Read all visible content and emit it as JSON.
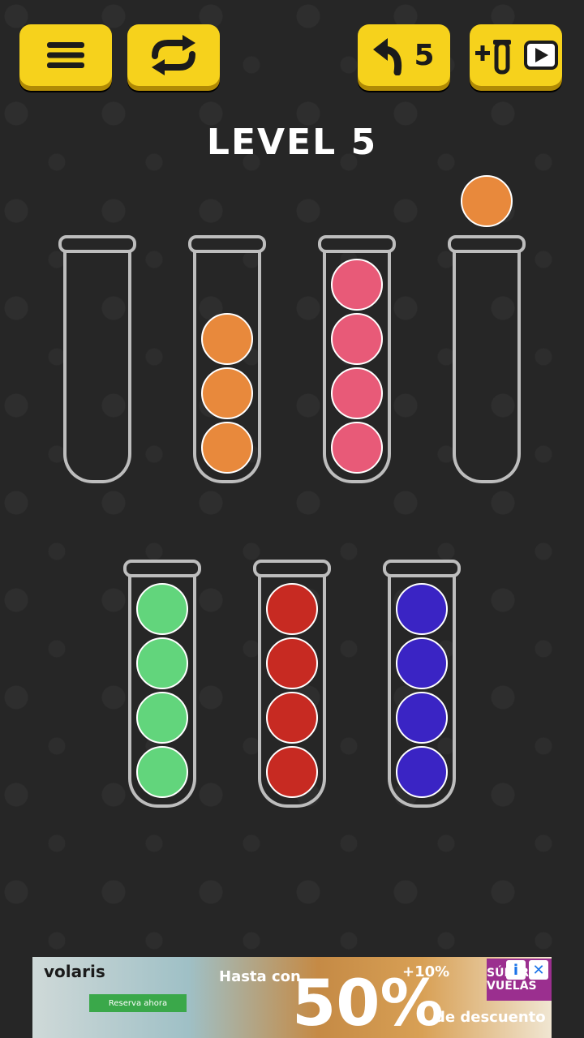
{
  "level_title": "LEVEL 5",
  "toolbar": {
    "menu_icon": "menu-icon",
    "restart_icon": "restart-icon",
    "undo_icon": "undo-icon",
    "undo_count": "5",
    "add_tube_icon": "add-tube-icon",
    "video_icon": "video-icon"
  },
  "colors": {
    "orange": "#e8893c",
    "pink": "#e85a78",
    "green": "#62d57c",
    "red": "#c72a22",
    "blue": "#3a24c4",
    "button": "#f6d21c",
    "tube": "#bdbdbd"
  },
  "tubes": [
    {
      "balls": []
    },
    {
      "balls": [
        "orange",
        "orange",
        "orange"
      ]
    },
    {
      "balls": [
        "pink",
        "pink",
        "pink",
        "pink"
      ]
    },
    {
      "balls": [],
      "lifted": "orange"
    },
    {
      "balls": [
        "green",
        "green",
        "green",
        "green"
      ]
    },
    {
      "balls": [
        "red",
        "red",
        "red",
        "red"
      ]
    },
    {
      "balls": [
        "blue",
        "blue",
        "blue",
        "blue"
      ]
    }
  ],
  "ad": {
    "brand": "volaris",
    "cta": "Reserva ahora",
    "hasta": "Hasta con",
    "big": "50%",
    "plus": "+10%",
    "desc": "de descuento",
    "tag": "SÚPER VUELAS",
    "info_icon": "info-icon",
    "close_icon": "close-icon"
  }
}
